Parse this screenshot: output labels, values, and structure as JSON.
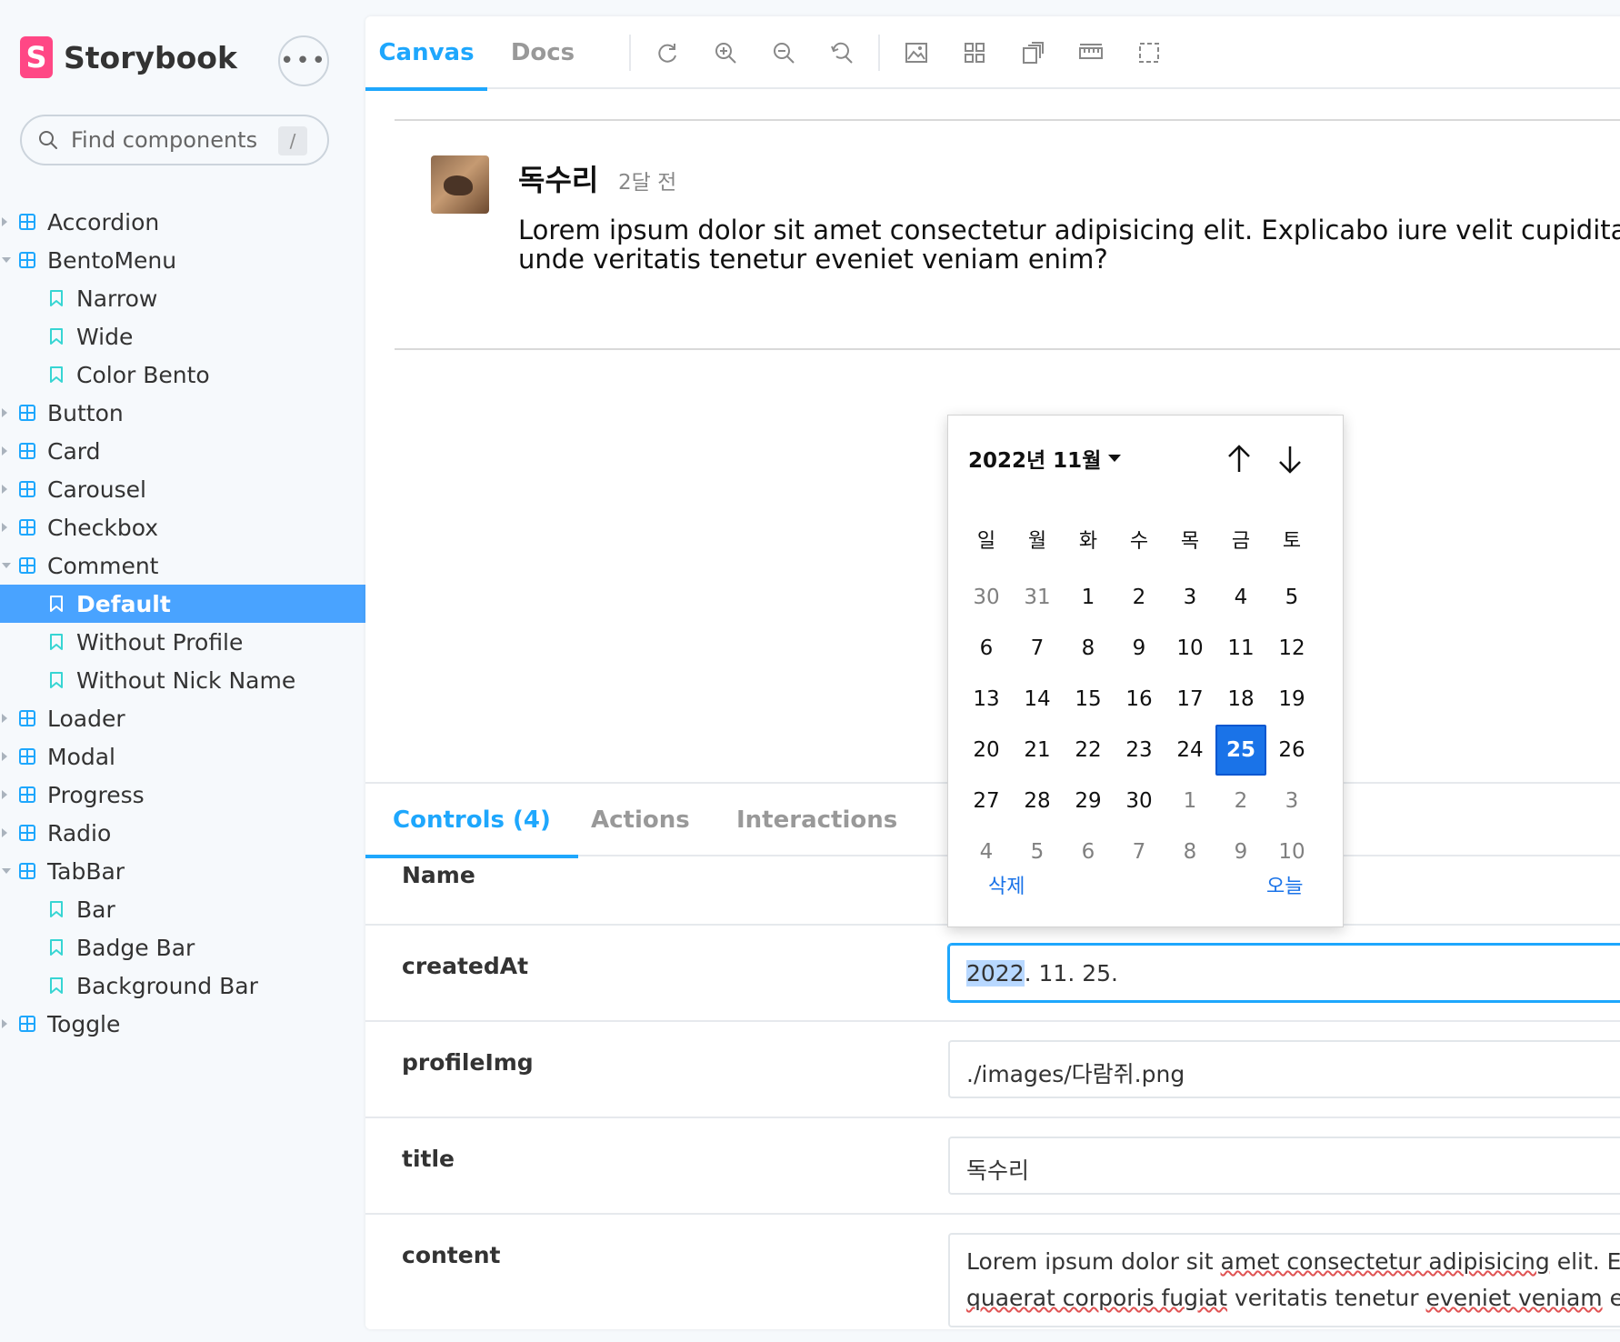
{
  "app": {
    "name": "Storybook",
    "more_label": "•••"
  },
  "search": {
    "placeholder": "Find components",
    "shortcut": "/"
  },
  "sidebar": {
    "items": [
      {
        "label": "Accordion",
        "kind": "component",
        "expanded": false
      },
      {
        "label": "BentoMenu",
        "kind": "component",
        "expanded": true
      },
      {
        "label": "Narrow",
        "kind": "story"
      },
      {
        "label": "Wide",
        "kind": "story"
      },
      {
        "label": "Color Bento",
        "kind": "story"
      },
      {
        "label": "Button",
        "kind": "component",
        "expanded": false
      },
      {
        "label": "Card",
        "kind": "component",
        "expanded": false
      },
      {
        "label": "Carousel",
        "kind": "component",
        "expanded": false
      },
      {
        "label": "Checkbox",
        "kind": "component",
        "expanded": false
      },
      {
        "label": "Comment",
        "kind": "component",
        "expanded": true
      },
      {
        "label": "Default",
        "kind": "story",
        "selected": true
      },
      {
        "label": "Without Profile",
        "kind": "story"
      },
      {
        "label": "Without Nick Name",
        "kind": "story"
      },
      {
        "label": "Loader",
        "kind": "component",
        "expanded": false
      },
      {
        "label": "Modal",
        "kind": "component",
        "expanded": false
      },
      {
        "label": "Progress",
        "kind": "component",
        "expanded": false
      },
      {
        "label": "Radio",
        "kind": "component",
        "expanded": false
      },
      {
        "label": "TabBar",
        "kind": "component",
        "expanded": true
      },
      {
        "label": "Bar",
        "kind": "story"
      },
      {
        "label": "Badge Bar",
        "kind": "story"
      },
      {
        "label": "Background Bar",
        "kind": "story"
      },
      {
        "label": "Toggle",
        "kind": "component",
        "expanded": false
      }
    ]
  },
  "toolbar": {
    "tabs": [
      {
        "label": "Canvas",
        "active": true
      },
      {
        "label": "Docs",
        "active": false
      }
    ],
    "tools": [
      "reload-icon",
      "zoom-in-icon",
      "zoom-out-icon",
      "zoom-reset-icon",
      "background-icon",
      "grid-icon",
      "viewport-icon",
      "measure-icon",
      "outline-icon"
    ]
  },
  "comment": {
    "name": "독수리",
    "time": "2달 전",
    "content": "Lorem ipsum dolor sit amet consectetur adipisicing elit. Explicabo iure velit cupiditate unde veritatis tenetur eveniet veniam enim?"
  },
  "addons": {
    "tabs": [
      {
        "label": "Controls (4)",
        "active": true
      },
      {
        "label": "Actions",
        "active": false
      },
      {
        "label": "Interactions",
        "active": false
      }
    ],
    "header_name": "Name",
    "rows": [
      {
        "name": "createdAt",
        "year": "2022",
        "rest": ". 11. 25."
      },
      {
        "name": "profileImg",
        "value": "./images/다람쥐.png"
      },
      {
        "name": "title",
        "value": "독수리"
      },
      {
        "name": "content",
        "line1_plain": "Lorem ipsum dolor sit ",
        "line1_wavy": "amet consectetur adipisicing",
        "line1_tail": " elit. Expl",
        "line2_wavy_a": "quaerat corporis fugiat",
        "line2_plain": " veritatis tenetur ",
        "line2_wavy_b": "eveniet veniam",
        "line2_tail": " enim"
      }
    ]
  },
  "datepicker": {
    "month_label": "2022년 11월",
    "weekdays": [
      "일",
      "월",
      "화",
      "수",
      "목",
      "금",
      "토"
    ],
    "weeks": [
      [
        {
          "d": "30",
          "o": true
        },
        {
          "d": "31",
          "o": true
        },
        {
          "d": "1"
        },
        {
          "d": "2"
        },
        {
          "d": "3"
        },
        {
          "d": "4"
        },
        {
          "d": "5"
        }
      ],
      [
        {
          "d": "6"
        },
        {
          "d": "7"
        },
        {
          "d": "8"
        },
        {
          "d": "9"
        },
        {
          "d": "10"
        },
        {
          "d": "11"
        },
        {
          "d": "12"
        }
      ],
      [
        {
          "d": "13"
        },
        {
          "d": "14"
        },
        {
          "d": "15"
        },
        {
          "d": "16"
        },
        {
          "d": "17"
        },
        {
          "d": "18"
        },
        {
          "d": "19"
        }
      ],
      [
        {
          "d": "20"
        },
        {
          "d": "21"
        },
        {
          "d": "22"
        },
        {
          "d": "23"
        },
        {
          "d": "24"
        },
        {
          "d": "25",
          "s": true
        },
        {
          "d": "26"
        }
      ],
      [
        {
          "d": "27"
        },
        {
          "d": "28"
        },
        {
          "d": "29"
        },
        {
          "d": "30"
        },
        {
          "d": "1",
          "o": true
        },
        {
          "d": "2",
          "o": true
        },
        {
          "d": "3",
          "o": true
        }
      ],
      [
        {
          "d": "4",
          "o": true
        },
        {
          "d": "5",
          "o": true
        },
        {
          "d": "6",
          "o": true
        },
        {
          "d": "7",
          "o": true
        },
        {
          "d": "8",
          "o": true
        },
        {
          "d": "9",
          "o": true
        },
        {
          "d": "10",
          "o": true
        }
      ]
    ],
    "clear_label": "삭제",
    "today_label": "오늘"
  },
  "colors": {
    "accent": "#1ea7fd",
    "selected_bg": "#49a3ff",
    "brand": "#ff4785",
    "picker_selected": "#1a73e8"
  }
}
